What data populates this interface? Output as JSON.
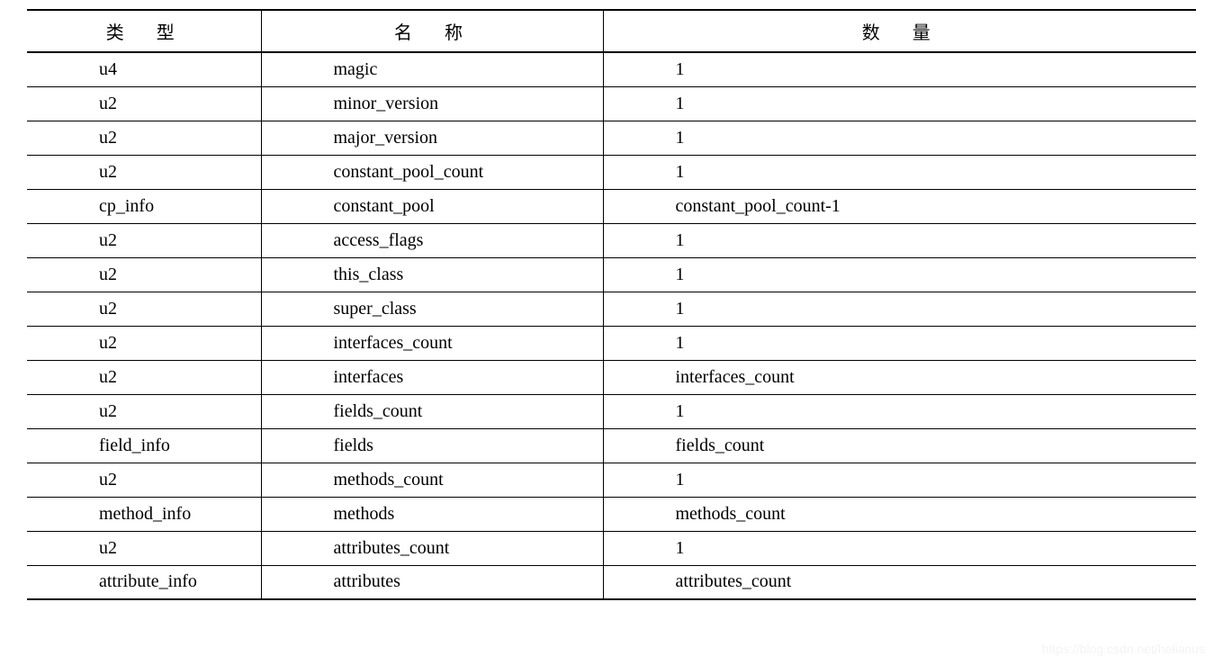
{
  "headers": {
    "type": "类　型",
    "name": "名　称",
    "count": "数　量"
  },
  "rows": [
    {
      "type": "u4",
      "name": "magic",
      "count": "1"
    },
    {
      "type": "u2",
      "name": "minor_version",
      "count": "1"
    },
    {
      "type": "u2",
      "name": "major_version",
      "count": "1"
    },
    {
      "type": "u2",
      "name": "constant_pool_count",
      "count": "1"
    },
    {
      "type": "cp_info",
      "name": "constant_pool",
      "count": "constant_pool_count-1"
    },
    {
      "type": "u2",
      "name": "access_flags",
      "count": "1"
    },
    {
      "type": "u2",
      "name": "this_class",
      "count": "1"
    },
    {
      "type": "u2",
      "name": "super_class",
      "count": "1"
    },
    {
      "type": "u2",
      "name": "interfaces_count",
      "count": "1"
    },
    {
      "type": "u2",
      "name": "interfaces",
      "count": "interfaces_count"
    },
    {
      "type": "u2",
      "name": "fields_count",
      "count": "1"
    },
    {
      "type": "field_info",
      "name": "fields",
      "count": "fields_count"
    },
    {
      "type": "u2",
      "name": "methods_count",
      "count": "1"
    },
    {
      "type": "method_info",
      "name": "methods",
      "count": "methods_count"
    },
    {
      "type": "u2",
      "name": "attributes_count",
      "count": "1"
    },
    {
      "type": "attribute_info",
      "name": "attributes",
      "count": "attributes_count"
    }
  ],
  "watermark": "https://blog.csdn.net/helianus"
}
